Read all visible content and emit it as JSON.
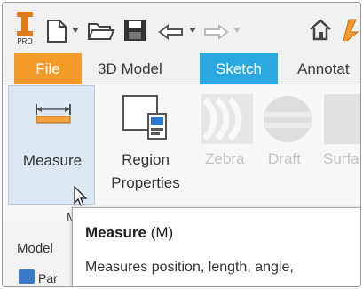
{
  "tabs": [
    {
      "label": "File"
    },
    {
      "label": "3D Model"
    },
    {
      "label": "Sketch"
    },
    {
      "label": "Annotat"
    }
  ],
  "ribbon": {
    "measure_label": "Measure",
    "region_label_line1": "Region",
    "region_label_line2": "Properties",
    "ghost_buttons": [
      "Zebra",
      "Draft",
      "Surfa"
    ],
    "panel_label": "M"
  },
  "browser": {
    "header": "Model",
    "item": "Par"
  },
  "tooltip": {
    "title": "Measure",
    "shortcut": "(M)",
    "description": "Measures position, length, angle,"
  },
  "icons": {
    "app": "inventor-pro-logo-icon",
    "new": "new-file-icon",
    "open": "open-folder-icon",
    "save": "save-icon",
    "undo": "undo-icon",
    "redo": "redo-icon",
    "home": "home-icon"
  },
  "colors": {
    "file_tab": "#f39a2b",
    "sketch_tab": "#2aa8e0",
    "measure_highlight": "#dde8f2"
  }
}
